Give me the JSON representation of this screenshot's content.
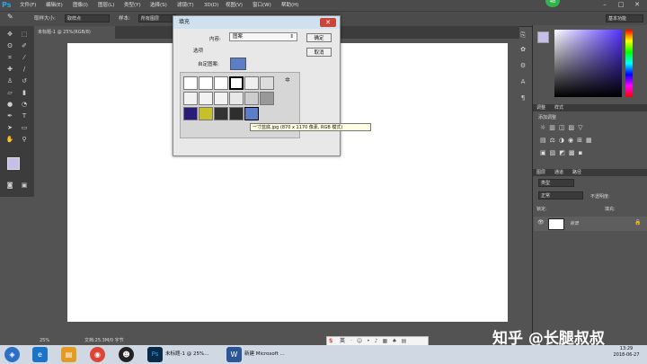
{
  "app": {
    "logo": "Ps"
  },
  "menu": [
    "文件(F)",
    "编辑(E)",
    "图像(I)",
    "图层(L)",
    "类型(Y)",
    "选择(S)",
    "滤镜(T)",
    "3D(D)",
    "视图(V)",
    "窗口(W)",
    "帮助(H)"
  ],
  "notification_badge": "48",
  "window_controls": [
    "–",
    "□",
    "✕"
  ],
  "options_bar": {
    "sample_size_label": "取样大小:",
    "sample_size_value": "取样点",
    "sample_label": "样本:",
    "sample_value": "所有图层",
    "workspace_value": "基本功能"
  },
  "document_tab": "未标题-1 @ 25%(RGB/8)",
  "fill_dialog": {
    "title": "填充",
    "content_label": "内容:",
    "content_value": "图案",
    "ok_label": "确定",
    "cancel_label": "取消",
    "options_label": "选项",
    "custom_pattern_label": "自定图案:",
    "tooltip": "一寸蓝底.jpg (870 x 1170 像素, RGB 模式)"
  },
  "status_bar": {
    "zoom": "25%",
    "doc_info": "文档:25.3M/0 字节"
  },
  "panels": {
    "adjustments_tab": "调整",
    "styles_tab": "样式",
    "add_adjustment_label": "添加调整",
    "layers_tab": "图层",
    "channels_tab": "通道",
    "paths_tab": "路径",
    "kind_label": "类型",
    "blend_mode": "正常",
    "opacity_label": "不透明度:",
    "lock_label": "锁定:",
    "fill_label": "填充:",
    "layer_name": "背景"
  },
  "taskbar": {
    "task_ps": "未标题-1 @ 25%...",
    "task_word": "新建 Microsoft ...",
    "clock_time": "13:29",
    "clock_date": "2018-06-27"
  },
  "ime": {
    "mode": "英"
  },
  "watermark": "知乎 @长腿叔叔",
  "colors": {
    "ps_blue": "#2fa3e6",
    "foreground": "#c5c0ea",
    "pattern_selected": "#5a7fc8"
  }
}
